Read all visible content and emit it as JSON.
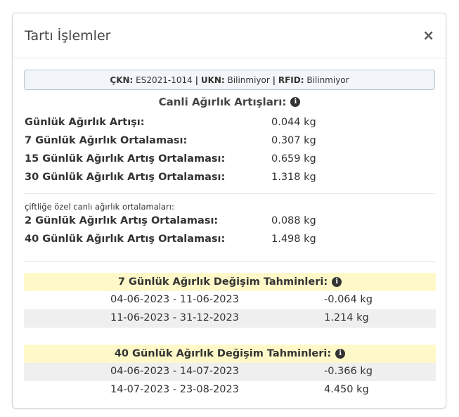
{
  "modal": {
    "title": "Tartı İşlemler",
    "close_label": "×"
  },
  "ids": {
    "ckn_label": "ÇKN:",
    "ckn_value": "ES2021-1014",
    "ukn_label": "UKN:",
    "ukn_value": "Bilinmiyor",
    "rfid_label": "RFID:",
    "rfid_value": "Bilinmiyor",
    "sep": "|"
  },
  "live": {
    "title": "Canli Ağırlık Artışları:",
    "info_icon": "info-icon",
    "rows": [
      {
        "label": "Günlük Ağırlık Artışı:",
        "value": "0.044 kg"
      },
      {
        "label": "7 Günlük Ağırlık Ortalaması:",
        "value": "0.307 kg"
      },
      {
        "label": "15 Günlük Ağırlık Artış Ortalaması:",
        "value": "0.659 kg"
      },
      {
        "label": "30 Günlük Ağırlık Artış Ortalaması:",
        "value": "1.318 kg"
      }
    ]
  },
  "farm": {
    "note": "çiftliğe özel canlı ağırlık ortalamaları:",
    "rows": [
      {
        "label": "2 Günlük Ağırlık Artış Ortalaması:",
        "value": "0.088 kg"
      },
      {
        "label": "40 Günlük Ağırlık Artış Ortalaması:",
        "value": "1.498 kg"
      }
    ]
  },
  "forecast7": {
    "title": "7 Günlük Ağırlık Değişim Tahminleri:",
    "rows": [
      {
        "range": "04-06-2023 - 11-06-2023",
        "value": "-0.064 kg"
      },
      {
        "range": "11-06-2023 - 31-12-2023",
        "value": "1.214 kg"
      }
    ]
  },
  "forecast40": {
    "title": "40 Günlük Ağırlık Değişim Tahminleri:",
    "rows": [
      {
        "range": "04-06-2023 - 14-07-2023",
        "value": "-0.366 kg"
      },
      {
        "range": "14-07-2023 - 23-08-2023",
        "value": "4.450 kg"
      }
    ]
  }
}
